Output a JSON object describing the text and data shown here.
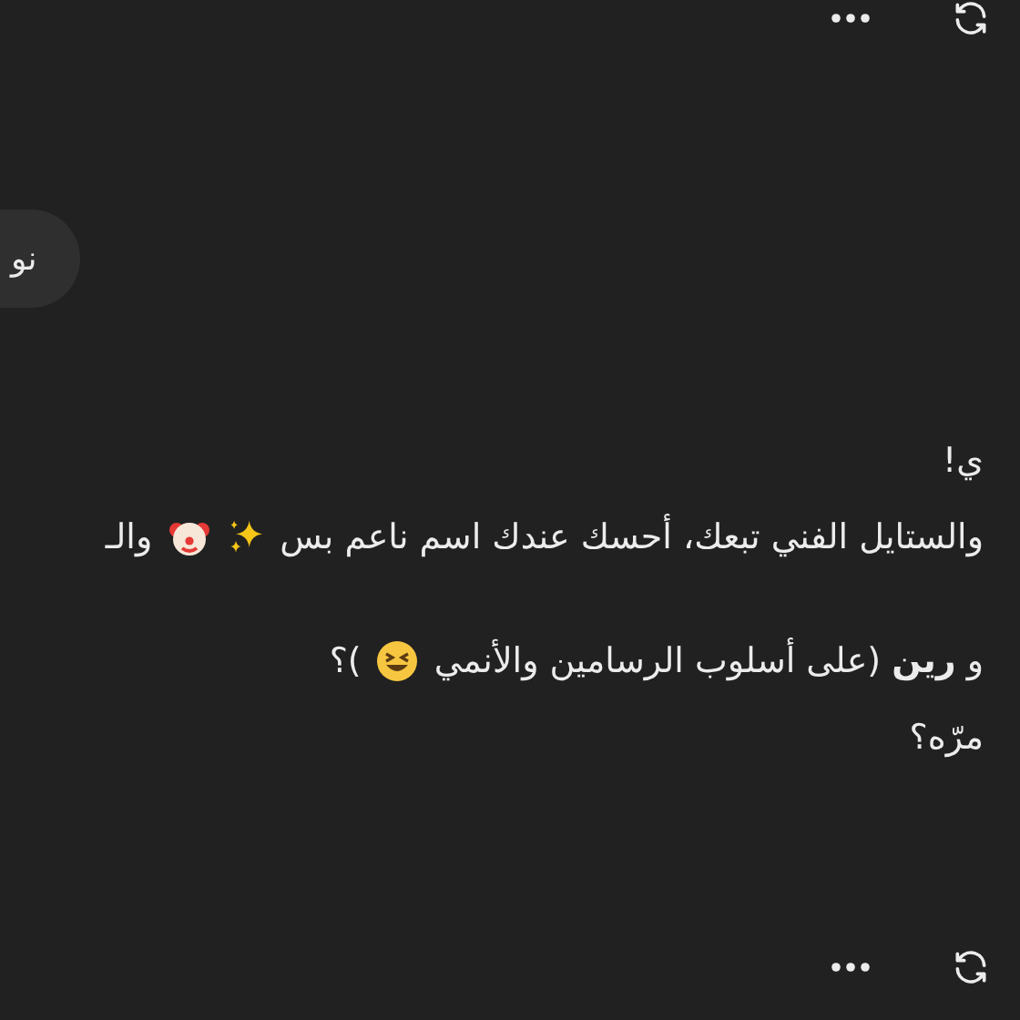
{
  "user_message": {
    "text": "نو"
  },
  "reply": {
    "paragraphs": [
      [
        [
          {
            "kind": "text",
            "text": "ي!"
          }
        ],
        [
          {
            "kind": "text",
            "text": "والستايل الفني تبعك، أحسك عندك اسم ناعم بس"
          },
          {
            "kind": "sparkles"
          },
          {
            "kind": "clown"
          },
          {
            "kind": "text",
            "text": "والـ"
          }
        ]
      ],
      [
        [
          {
            "kind": "text",
            "text": "و **رين** (على أسلوب الرسامين والأنمي"
          },
          {
            "kind": "laughing"
          },
          {
            "kind": "text",
            "text": ")؟"
          }
        ],
        [
          {
            "kind": "text",
            "text": "مرّه؟"
          }
        ]
      ]
    ]
  }
}
